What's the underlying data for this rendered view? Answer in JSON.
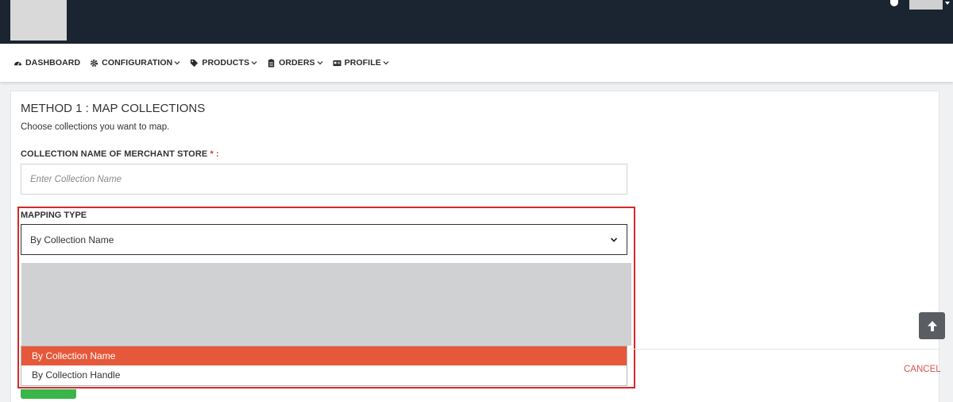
{
  "nav": {
    "items": [
      {
        "label": "DASHBOARD",
        "icon": "dashboard-icon",
        "has_dropdown": false
      },
      {
        "label": "CONFIGURATION",
        "icon": "gear-icon",
        "has_dropdown": true
      },
      {
        "label": "PRODUCTS",
        "icon": "tag-icon",
        "has_dropdown": true
      },
      {
        "label": "ORDERS",
        "icon": "clipboard-icon",
        "has_dropdown": true
      },
      {
        "label": "PROFILE",
        "icon": "id-card-icon",
        "has_dropdown": true
      }
    ]
  },
  "form": {
    "title": "METHOD 1 : MAP COLLECTIONS",
    "subtitle": "Choose collections you want to map.",
    "collection_label": "COLLECTION NAME OF MERCHANT STORE",
    "required_mark": "* :",
    "collection_placeholder": "Enter Collection Name",
    "mapping_label": "MAPPING TYPE",
    "mapping_selected": "By Collection Name",
    "mapping_options": [
      "By Collection Name",
      "By Collection Handle"
    ],
    "cancel_label": "CANCEL"
  },
  "colors": {
    "topbar": "#1b2431",
    "accent": "#e6583a",
    "highlight_border": "#d52a2a",
    "cancel": "#d9534f",
    "primary_button": "#3ab54a"
  }
}
